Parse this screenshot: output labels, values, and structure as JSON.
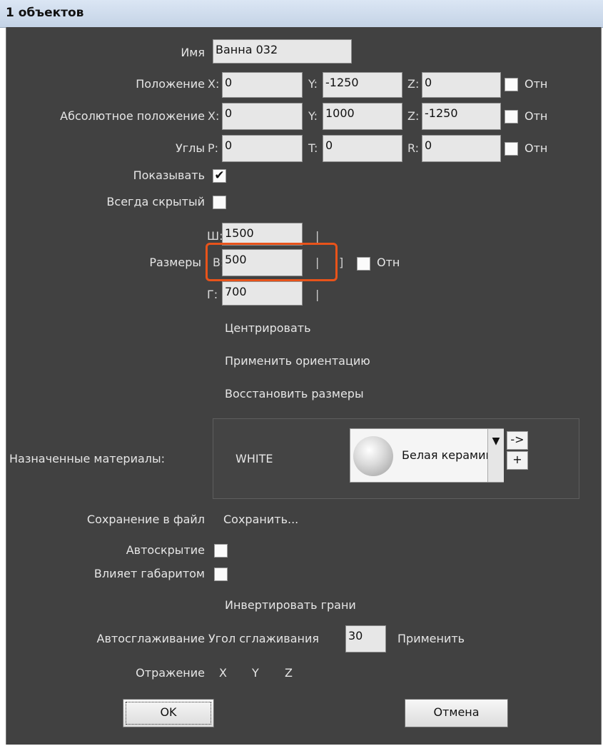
{
  "window": {
    "title": "1 объектов"
  },
  "name": {
    "label": "Имя",
    "value": "Ванна 032"
  },
  "position": {
    "label": "Положение",
    "x": "0",
    "y": "-1250",
    "z": "0",
    "rel": "Отн"
  },
  "abs_position": {
    "label": "Абсолютное положение",
    "x": "0",
    "y": "1000",
    "z": "-1250",
    "rel": "Отн"
  },
  "angles": {
    "label": "Углы",
    "p": "0",
    "t": "0",
    "r": "0",
    "rel": "Отн"
  },
  "axes": {
    "x": "X:",
    "y": "Y:",
    "z": "Z:",
    "p": "P:",
    "t": "T:",
    "r": "R:"
  },
  "show": {
    "label": "Показывать",
    "checked": true
  },
  "always_hidden": {
    "label": "Всегда скрытый",
    "checked": false
  },
  "size": {
    "label": "Размеры",
    "w_axis": "Ш:",
    "w": "1500",
    "h_axis": "В:",
    "h": "500",
    "d_axis": "Г:",
    "d": "700",
    "rel": "Отн",
    "sep": "|",
    "bracket": "]"
  },
  "actions": {
    "center": "Центрировать",
    "apply_orientation": "Применить ориентацию",
    "restore_sizes": "Восстановить размеры"
  },
  "materials": {
    "label": "Назначенные материалы:",
    "slot": "WHITE",
    "selected": "Белая керамика",
    "btn_arrow": "->",
    "btn_plus": "+"
  },
  "save": {
    "label": "Сохранение в файл",
    "button": "Сохранить..."
  },
  "autohide": {
    "label": "Автоскрытие"
  },
  "affects_bounds": {
    "label": "Влияет габаритом"
  },
  "invert_faces": "Инвертировать грани",
  "smoothing": {
    "label": "Автосглаживание",
    "angle_label": "Угол сглаживания",
    "angle": "30",
    "apply": "Применить"
  },
  "reflection": {
    "label": "Отражение",
    "x": "X",
    "y": "Y",
    "z": "Z"
  },
  "buttons": {
    "ok": "OK",
    "cancel": "Отмена"
  },
  "colors": {
    "panel": "#414141",
    "highlight": "#e8531a",
    "title_bar": "#c9d7e8"
  }
}
